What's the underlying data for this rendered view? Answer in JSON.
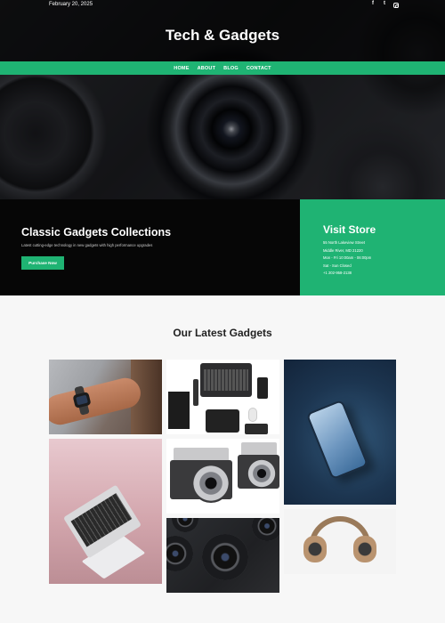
{
  "topbar": {
    "date": "February 20, 2025",
    "social_icons": [
      "facebook-icon",
      "twitter-icon",
      "instagram-icon"
    ],
    "facebook_glyph": "f",
    "twitter_glyph": "t"
  },
  "site": {
    "title": "Tech & Gadgets"
  },
  "nav": {
    "items": [
      "HOME",
      "ABOUT",
      "BLOG",
      "CONTACT"
    ]
  },
  "feature": {
    "title": "Classic Gadgets Collections",
    "subtitle": "Latest cutting-edge technology in new gadgets with high performance upgrades",
    "button_label": "Purchase Now"
  },
  "store": {
    "title": "Visit Store",
    "lines": [
      "55 North Lakeview Street",
      "Middle River, MD 21220",
      "Mon - Fri 10:00am - 06:00pm",
      "Sat - Sun Closed",
      "+1 202-958-2138"
    ]
  },
  "gallery": {
    "title": "Our Latest Gadgets",
    "images": [
      "smartwatch-on-wrist",
      "laptop-flatlay",
      "smartphone",
      "laptop-on-pink",
      "film-cameras",
      "camera-lenses",
      "headphones"
    ]
  },
  "colors": {
    "accent": "#1fb373",
    "dark": "#060606",
    "background": "#f7f7f7"
  }
}
